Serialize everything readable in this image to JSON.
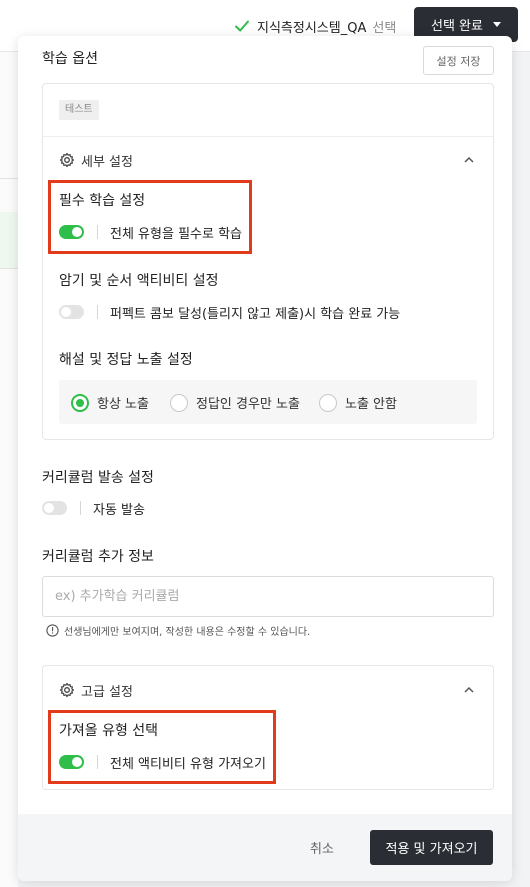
{
  "header": {
    "selected_name": "지식측정시스템_QA",
    "selected_suffix": "선택",
    "confirm_label": "선택 완료"
  },
  "panel": {
    "title": "학습 옵션",
    "save_settings_label": "설정 저장",
    "tag": "테스트",
    "detail_settings": {
      "title": "세부 설정",
      "required_learning": {
        "heading": "필수 학습 설정",
        "toggle_on": true,
        "toggle_label": "전체 유형을 필수로 학습"
      },
      "memorize_order": {
        "heading": "암기 및 순서 액티비티 설정",
        "toggle_on": false,
        "toggle_label": "퍼펙트 콤보 달성(틀리지 않고 제출)시 학습 완료 가능"
      },
      "explanation": {
        "heading": "해설 및 정답 노출 설정",
        "options": [
          "항상 노출",
          "정답인 경우만 노출",
          "노출 안함"
        ],
        "selected": "항상 노출"
      }
    },
    "curriculum_send": {
      "heading": "커리큘럼 발송 설정",
      "toggle_on": false,
      "toggle_label": "자동 발송"
    },
    "curriculum_extra": {
      "heading": "커리큘럼 추가 정보",
      "value": "",
      "placeholder": "ex) 추가학습 커리큘럼",
      "note": "선생님에게만 보여지며, 작성한 내용은 수정할 수 있습니다."
    },
    "advanced_settings": {
      "title": "고급 설정",
      "import_type": {
        "heading": "가져올 유형 선택",
        "toggle_on": true,
        "toggle_label": "전체 액티비티 유형 가져오기"
      }
    }
  },
  "footer": {
    "cancel_label": "취소",
    "apply_label": "적용 및 가져오기"
  },
  "colors": {
    "accent_green": "#2fbe4a",
    "dark_button": "#2a2d33",
    "highlight_red": "#e23b1b"
  }
}
